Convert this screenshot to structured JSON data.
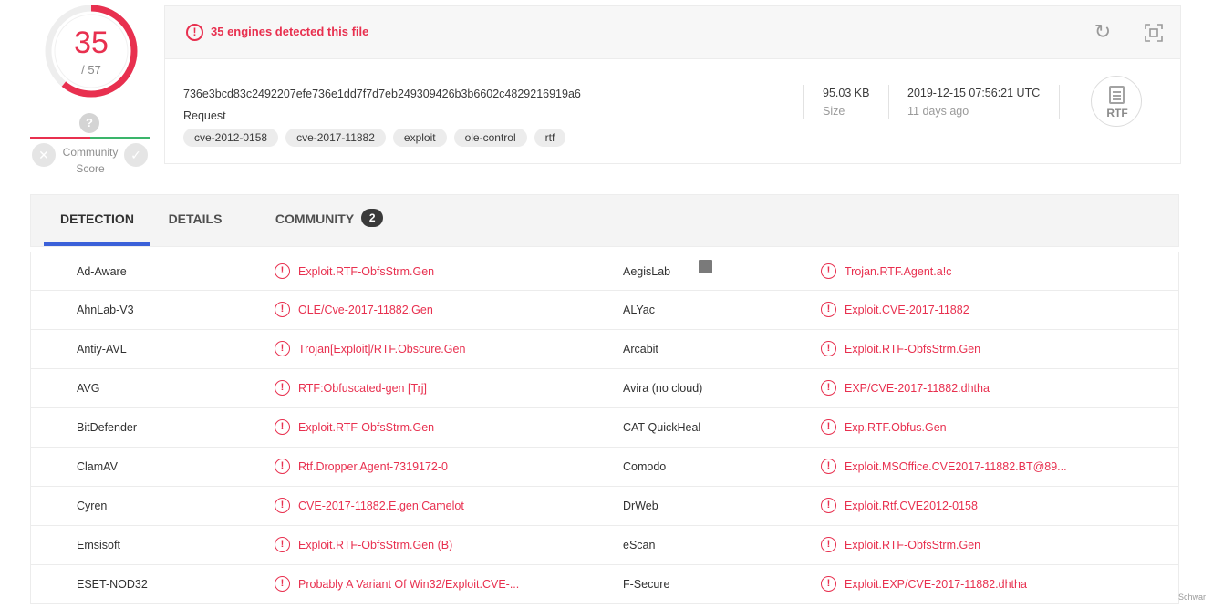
{
  "score": {
    "detected": "35",
    "total": "/ 57"
  },
  "community": {
    "label": "Community Score",
    "help": "?",
    "x_icon": "close-icon",
    "check_icon": "check-icon"
  },
  "header": {
    "alert": "35 engines detected this file",
    "hash": "736e3bcd83c2492207efe736e1dd7f7d7eb249309426b3b6602c4829216919a6",
    "request": "Request",
    "tags": [
      "cve-2012-0158",
      "cve-2017-11882",
      "exploit",
      "ole-control",
      "rtf"
    ],
    "size_value": "95.03 KB",
    "size_label": "Size",
    "date_value": "2019-12-15 07:56:21 UTC",
    "date_label": "11 days ago",
    "filetype": "RTF"
  },
  "tabs": {
    "detection": "DETECTION",
    "details": "DETAILS",
    "community": "COMMUNITY",
    "community_count": "2"
  },
  "rows": [
    {
      "left_engine": "Ad-Aware",
      "left_result": "Exploit.RTF-ObfsStrm.Gen",
      "right_engine": "AegisLab",
      "right_result": "Trojan.RTF.Agent.a!c"
    },
    {
      "left_engine": "AhnLab-V3",
      "left_result": "OLE/Cve-2017-11882.Gen",
      "right_engine": "ALYac",
      "right_result": "Exploit.CVE-2017-11882"
    },
    {
      "left_engine": "Antiy-AVL",
      "left_result": "Trojan[Exploit]/RTF.Obscure.Gen",
      "right_engine": "Arcabit",
      "right_result": "Exploit.RTF-ObfsStrm.Gen"
    },
    {
      "left_engine": "AVG",
      "left_result": "RTF:Obfuscated-gen [Trj]",
      "right_engine": "Avira (no cloud)",
      "right_result": "EXP/CVE-2017-11882.dhtha"
    },
    {
      "left_engine": "BitDefender",
      "left_result": "Exploit.RTF-ObfsStrm.Gen",
      "right_engine": "CAT-QuickHeal",
      "right_result": "Exp.RTF.Obfus.Gen"
    },
    {
      "left_engine": "ClamAV",
      "left_result": "Rtf.Dropper.Agent-7319172-0",
      "right_engine": "Comodo",
      "right_result": "Exploit.MSOffice.CVE2017-11882.BT@89..."
    },
    {
      "left_engine": "Cyren",
      "left_result": "CVE-2017-11882.E.gen!Camelot",
      "right_engine": "DrWeb",
      "right_result": "Exploit.Rtf.CVE2012-0158"
    },
    {
      "left_engine": "Emsisoft",
      "left_result": "Exploit.RTF-ObfsStrm.Gen (B)",
      "right_engine": "eScan",
      "right_result": "Exploit.RTF-ObfsStrm.Gen"
    },
    {
      "left_engine": "ESET-NOD32",
      "left_result": "Probably A Variant Of Win32/Exploit.CVE-...",
      "right_engine": "F-Secure",
      "right_result": "Exploit.EXP/CVE-2017-11882.dhtha"
    }
  ],
  "watermark": "Schwar",
  "colors": {
    "malicious": "#e8304f",
    "accent": "#3b61d9",
    "positive": "#3ab56b"
  }
}
